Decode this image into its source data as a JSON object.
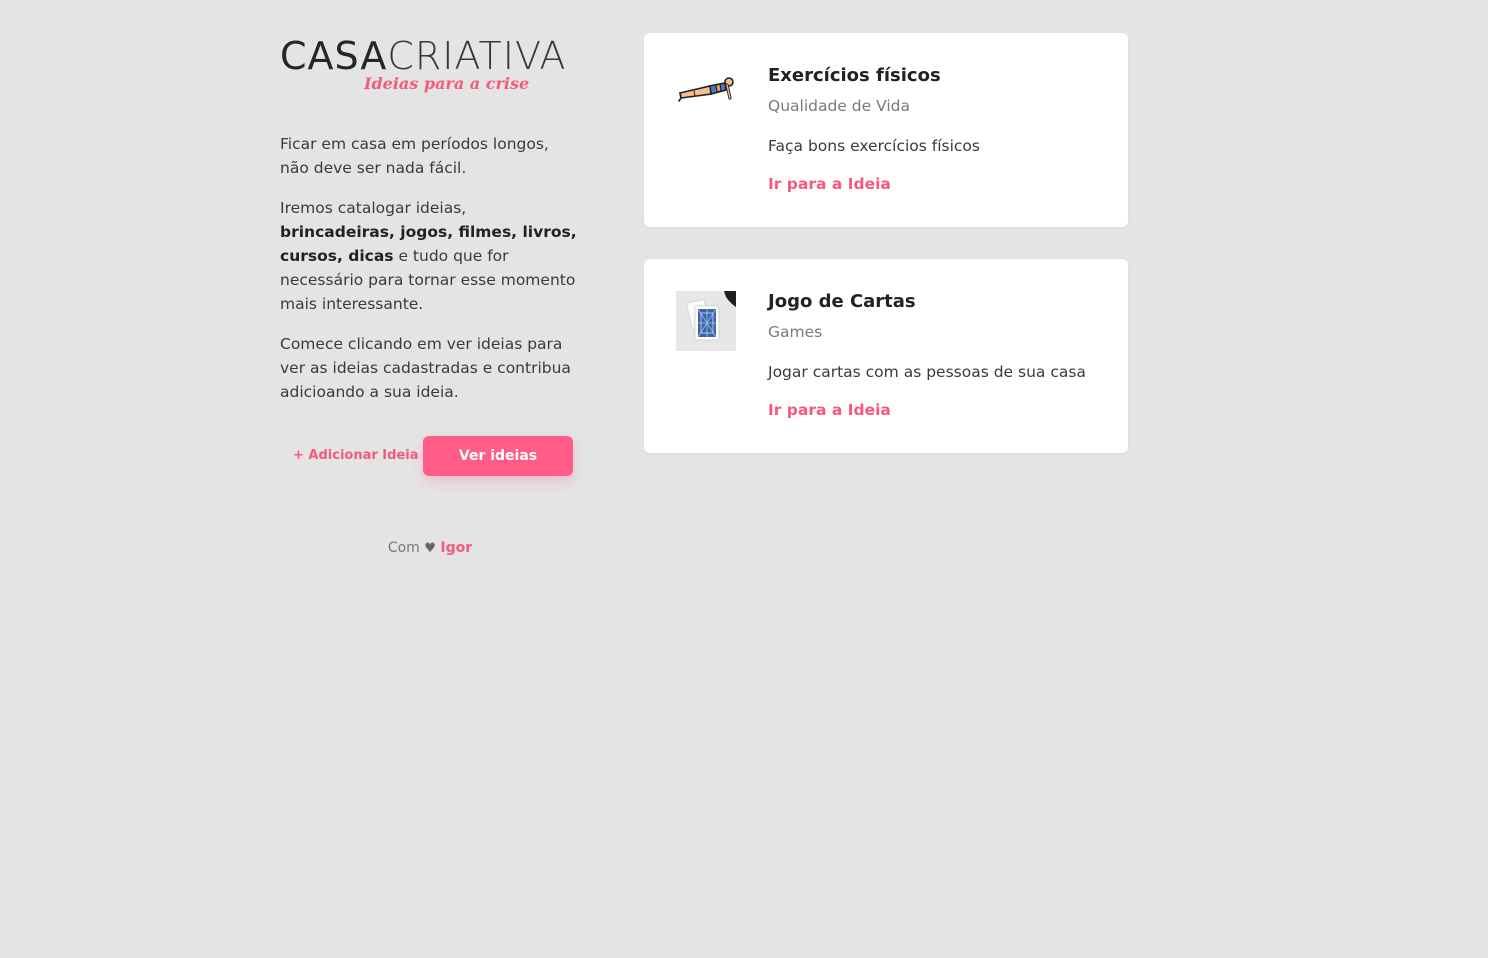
{
  "logo": {
    "part1": "CASA",
    "part2": "CRIATIVA",
    "tagline": "Ideias para a crise"
  },
  "intro": {
    "p1": "Ficar em casa em períodos longos, não deve ser nada fácil.",
    "p2_before": "Iremos catalogar ideias, ",
    "p2_bold": "brincadeiras, jogos, filmes, livros, cursos, dicas",
    "p2_after": " e tudo que for necessário para tornar esse momento mais interessante.",
    "p3": "Comece clicando em ver ideias para ver as ideias cadastradas e contribua adicioando a sua ideia."
  },
  "actions": {
    "add_label": "+ Adicionar Ideia",
    "view_label": "Ver ideias"
  },
  "footer": {
    "prefix": "Com",
    "heart": "♥",
    "author": "Igor"
  },
  "ideas": [
    {
      "icon": "exercise-plank-icon",
      "title": "Exercícios físicos",
      "category": "Qualidade de Vida",
      "description": "Faça bons exercícios físicos",
      "link_label": "Ir para a Ideia"
    },
    {
      "icon": "playing-cards-photo",
      "title": "Jogo de Cartas",
      "category": "Games",
      "description": "Jogar cartas com as pessoas de sua casa",
      "link_label": "Ir para a Ideia"
    }
  ],
  "colors": {
    "background": "#e4e4e4",
    "accent": "#f5597e",
    "button": "#ff5d87",
    "card": "#ffffff"
  }
}
